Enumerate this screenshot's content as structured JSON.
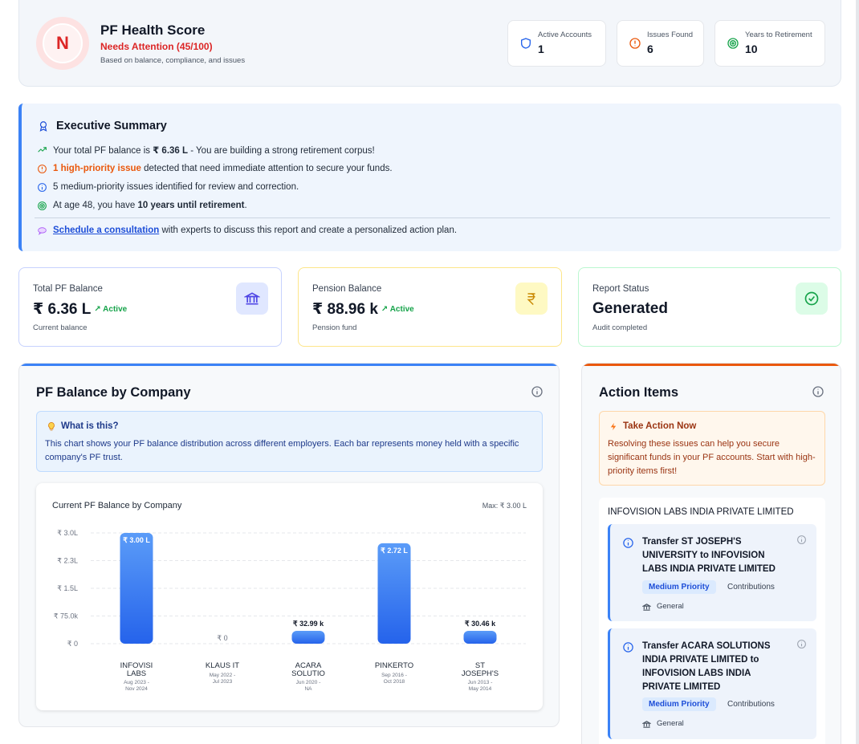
{
  "health": {
    "grade": "N",
    "title": "PF Health Score",
    "status": "Needs Attention (45/100)",
    "note": "Based on balance, compliance, and issues",
    "metrics": [
      {
        "label": "Active Accounts",
        "value": "1",
        "icon": "shield-icon"
      },
      {
        "label": "Issues Found",
        "value": "6",
        "icon": "alert-circle-icon"
      },
      {
        "label": "Years to Retirement",
        "value": "10",
        "icon": "target-icon"
      }
    ]
  },
  "summary": {
    "title": "Executive Summary",
    "line1_pre": "Your total PF balance is ",
    "line1_bold": "₹ 6.36 L",
    "line1_post": " - You are building a strong retirement corpus!",
    "line2_link": "1 high-priority issue",
    "line2_post": " detected that need immediate attention to secure your funds.",
    "line3": "5 medium-priority issues identified for review and correction.",
    "line4_pre": "At age 48, you have ",
    "line4_bold": "10 years until retirement",
    "line4_post": ".",
    "consult_link": "Schedule a consultation",
    "consult_post": " with experts to discuss this report and create a personalized action plan."
  },
  "stats": [
    {
      "label": "Total PF Balance",
      "value": "₹ 6.36 L",
      "active": "Active",
      "sub": "Current balance"
    },
    {
      "label": "Pension Balance",
      "value": "₹ 88.96 k",
      "active": "Active",
      "sub": "Pension fund"
    },
    {
      "label": "Report Status",
      "value": "Generated",
      "sub": "Audit completed"
    }
  ],
  "chart_panel": {
    "title": "PF Balance by Company",
    "what_title": "What is this?",
    "what_text": "This chart shows your PF balance distribution across different employers. Each bar represents money held with a specific company's PF trust."
  },
  "chart_data": {
    "type": "bar",
    "title": "Current PF Balance by Company",
    "max_label": "Max: ₹ 3.00 L",
    "yticks": [
      "₹ 3.0L",
      "₹ 2.3L",
      "₹ 1.5L",
      "₹ 75.0k",
      "₹ 0"
    ],
    "ylim": [
      0,
      300000
    ],
    "categories": [
      {
        "l1": "INFOVISI",
        "l2": "LABS",
        "d1": "Aug 2023 -",
        "d2": "Nov 2024"
      },
      {
        "l1": "KLAUS IT",
        "l2": "",
        "d1": "May 2022 -",
        "d2": "Jul 2023"
      },
      {
        "l1": "ACARA",
        "l2": "SOLUTIO",
        "d1": "Jun 2020 -",
        "d2": "NA"
      },
      {
        "l1": "PINKERTO",
        "l2": "",
        "d1": "Sep 2016 -",
        "d2": "Oct 2018"
      },
      {
        "l1": "ST",
        "l2": "JOSEPH'S",
        "d1": "Jun 2013 -",
        "d2": "May 2014"
      }
    ],
    "values": [
      300000,
      0,
      32990,
      272000,
      30460
    ],
    "labels": [
      "₹ 3.00 L",
      "₹ 0",
      "₹ 32.99 k",
      "₹ 2.72 L",
      "₹ 30.46 k"
    ]
  },
  "actions": {
    "title": "Action Items",
    "take_title": "Take Action Now",
    "take_text": "Resolving these issues can help you secure significant funds in your PF accounts. Start with high-priority items first!",
    "company": "INFOVISION LABS INDIA PRIVATE LIMITED",
    "items": [
      {
        "title": "Transfer ST JOSEPH'S UNIVERSITY to INFOVISION LABS INDIA PRIVATE LIMITED",
        "priority": "Medium Priority",
        "category": "Contributions",
        "tag": "General"
      },
      {
        "title": "Transfer ACARA SOLUTIONS INDIA PRIVATE LIMITED to INFOVISION LABS INDIA PRIVATE LIMITED",
        "priority": "Medium Priority",
        "category": "Contributions",
        "tag": "General"
      }
    ]
  },
  "colors": {
    "accent": "#3b82f6",
    "danger": "#dc2626",
    "success": "#16a34a",
    "warning": "#ea580c"
  }
}
